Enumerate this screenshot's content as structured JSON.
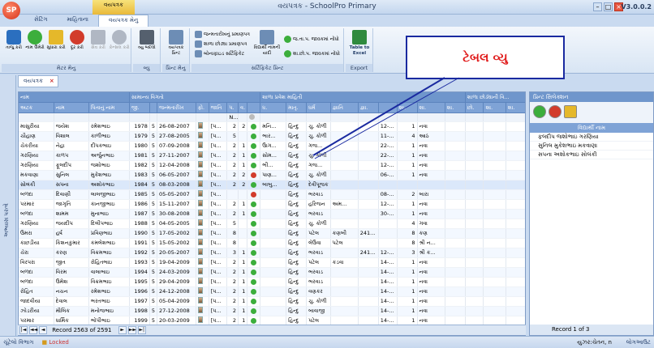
{
  "app": {
    "title": "વયપત્રક - SchoolPro Primary",
    "version": "V3.0.0.2",
    "logo": "SP",
    "context_tab": "વયપત્રક"
  },
  "tabs": [
    "સેટિંગ",
    "માહિતાના",
    "વયપત્રક મેનુ"
  ],
  "ribbon": {
    "groups": [
      "મેટર મેનુ",
      "વ્યુ",
      "પ્રિન્ટ મેનુ",
      "સર્ટિફિકેટ પ્રિન્ટ",
      "Export"
    ],
    "buttons": [
      {
        "label": "તાજું કરો",
        "icon": "refresh-icon",
        "color": "#2b6fbf"
      },
      {
        "label": "નામ ઉમેરો",
        "icon": "add-icon",
        "color": "#3cae3c"
      },
      {
        "label": "સુધારા કરો",
        "icon": "edit-icon",
        "color": "#e5b82a"
      },
      {
        "label": "દૂર કરો",
        "icon": "delete-icon",
        "color": "#d23c2c"
      },
      {
        "label": "સેવ કરો",
        "icon": "save-icon",
        "color": "#b0b7c3"
      },
      {
        "label": "કેન્સલ કરો",
        "icon": "cancel-icon",
        "color": "#b0b7c3"
      }
    ],
    "view_button": "વ્યુ બદલો",
    "print_button": "વયપત્રક પ્રિન્ટ",
    "certs": [
      "જન્મતારીખનું પ્રમાણપત્ર",
      "શાળા છોડ્યા પ્રમાણપત્ર",
      "બોનાફાઇડ સર્ટિફિકેટ"
    ],
    "cert_list_button": "વિદ્યાર્થી નામની યાદી",
    "lists": [
      "જ.તા.પ. જાવકમાં નોંધો",
      "શા.છો.પ. જાવકમાં નોંધો"
    ],
    "export_button": "Table to Excel"
  },
  "callout": "ટેબલ વ્યુ",
  "doc_tab": "વયપત્રક",
  "left_bar": "અભ્યાસ પરત્વે",
  "grid": {
    "bands": [
      "નામ",
      "સામાન્ય વિગતો",
      "શાળા પ્રવેશ માહિતી",
      "શાળા છોડ્યાની વિ..."
    ],
    "columns": [
      "અટક",
      "નામ",
      "પિતાનું નામ",
      "જી.",
      "",
      "જન્મતારીખ",
      "ફો.",
      "જાતિ",
      "પ.",
      "વ.",
      "",
      "ધ.",
      "માતૃ.",
      "ધર્મ",
      "જ્ઞાતિ",
      "જ્ઞા.",
      "",
      "શા.",
      "શા.",
      "શા.",
      "છો.",
      "શા.",
      "શા."
    ],
    "filter_text": "N...",
    "rows": [
      {
        "last": "માસુરીયા",
        "first": "જયેશ",
        "father": "રમેશભાઇ",
        "year": "1978",
        "day": "5",
        "dob": "26-08-2007",
        "p1": "[પ...",
        "n1": "2",
        "n2": "2",
        "status": "green",
        "c1": "મનિ...",
        "c2": "હિન્દુ",
        "c3": "ચુ. કોળી",
        "c4": "",
        "c5": "",
        "c6": "12-...",
        "c7": "1",
        "c8": "નવા"
      },
      {
        "last": "ચૌહાણ",
        "first": "વિશાલ",
        "father": "કાળીભાઇ",
        "year": "1979",
        "day": "5",
        "dob": "27-08-2005",
        "p1": "[પ...",
        "n1": "5",
        "n2": "",
        "status": "green",
        "c1": "ભાર...",
        "c2": "હિન્દુ",
        "c3": "ચુ. કોળી",
        "c4": "",
        "c5": "",
        "c6": "11-...",
        "c7": "4",
        "c8": "આઠ"
      },
      {
        "last": "ચેકરીયા",
        "first": "નેહા",
        "father": "દીપકભાઇ",
        "year": "1980",
        "day": "5",
        "dob": "07-09-2008",
        "p1": "[પ...",
        "n1": "2",
        "n2": "1",
        "status": "green",
        "c1": "ઉાગ...",
        "c2": "હિન્દુ",
        "c3": "ગજ...",
        "c4": "",
        "c5": "",
        "c6": "22-...",
        "c7": "1",
        "c8": "નવા"
      },
      {
        "last": "ગરણિયા",
        "first": "કાળપ",
        "father": "અર્જુનભાઇ",
        "year": "1981",
        "day": "5",
        "dob": "27-11-2007",
        "p1": "[પ...",
        "n1": "2",
        "n2": "1",
        "status": "green",
        "c1": "સોમ...",
        "c2": "હિન્દુ",
        "c3": "ચુ. કોળી",
        "c4": "",
        "c5": "",
        "c6": "22-...",
        "c7": "1",
        "c8": "નવા"
      },
      {
        "last": "ગરણિયા",
        "first": "ફૂલદીપ",
        "father": "જશોભાઇ",
        "year": "1982",
        "day": "5",
        "dob": "12-04-2008",
        "p1": "[પ...",
        "n1": "2",
        "n2": "1",
        "status": "green",
        "c1": "ભી...",
        "c2": "હિન્દુ",
        "c3": "ગજ...",
        "c4": "",
        "c5": "",
        "c6": "12-...",
        "c7": "1",
        "c8": "નવા"
      },
      {
        "last": "મકવાણા",
        "first": "સુનિલ",
        "father": "મુકેશભાઇ",
        "year": "1983",
        "day": "5",
        "dob": "06-05-2007",
        "p1": "[પ...",
        "n1": "2",
        "n2": "2",
        "status": "red",
        "c1": "પાણ...",
        "c2": "હિન્દુ",
        "c3": "ચુ. કોળી",
        "c4": "",
        "c5": "",
        "c6": "06-...",
        "c7": "1",
        "c8": "નવા"
      },
      {
        "last": "સોલંકી",
        "first": "સપના",
        "father": "અશોકભાઇ",
        "year": "1984",
        "day": "5",
        "dob": "08-03-2008",
        "p1": "[પ...",
        "n1": "2",
        "n2": "2",
        "status": "green",
        "c1": "બાબુ...",
        "c2": "હિન્દુ",
        "c3": "દેવીપૂજક",
        "c4": "",
        "c5": "",
        "c6": "",
        "c7": "",
        "c8": ""
      },
      {
        "last": "બળદા",
        "first": "દિવાણી",
        "father": "લાલજીભાઇ",
        "year": "1985",
        "day": "5",
        "dob": "05-05-2007",
        "p1": "[પ...",
        "n1": "",
        "n2": "",
        "status": "red",
        "c1": "",
        "c2": "હિન્દુ",
        "c3": "ભરવાડ",
        "c4": "",
        "c5": "",
        "c6": "08-...",
        "c7": "2",
        "c8": "બારા"
      },
      {
        "last": "પરમાર",
        "first": "જાગૃતિ",
        "father": "કાનજીભાઇ",
        "year": "1986",
        "day": "5",
        "dob": "15-11-2007",
        "p1": "[પ...",
        "n1": "2",
        "n2": "1",
        "status": "green",
        "c1": "",
        "c2": "હિન્દુ",
        "c3": "હરિજન",
        "c4": "અમ...",
        "c5": "",
        "c6": "12-...",
        "c7": "1",
        "c8": "નવા"
      },
      {
        "last": "બળદા",
        "first": "શામમ",
        "father": "મુનાભાઇ",
        "year": "1987",
        "day": "5",
        "dob": "30-08-2008",
        "p1": "[પ...",
        "n1": "2",
        "n2": "1",
        "status": "green",
        "c1": "",
        "c2": "હિન્દુ",
        "c3": "ભરવાડ",
        "c4": "",
        "c5": "",
        "c6": "30-...",
        "c7": "1",
        "c8": "નવા"
      },
      {
        "last": "ગરણિયા",
        "first": "જયદીપ",
        "father": "દિલીપભાઇ",
        "year": "1988",
        "day": "5",
        "dob": "04-05-2005",
        "p1": "[પ...",
        "n1": "5",
        "n2": "",
        "status": "green",
        "c1": "",
        "c2": "હિન્દુ",
        "c3": "ચુ. કોળી",
        "c4": "",
        "c5": "",
        "c6": "",
        "c7": "4",
        "c8": "ગવા"
      },
      {
        "last": "ઉમરા",
        "first": "હર્ષ",
        "father": "પ્રવિણભાઇ",
        "year": "1990",
        "day": "5",
        "dob": "17-05-2002",
        "p1": "[પ...",
        "n1": "8",
        "n2": "",
        "status": "green",
        "c1": "",
        "c2": "હિન્દુ",
        "c3": "પટેલ",
        "c4": "કણબી",
        "c5": "241...",
        "c6": "",
        "c7": "8",
        "c8": "કણ"
      },
      {
        "last": "કાછડીયા",
        "first": "કિશનકુમાર",
        "father": "કમલેશભાઇ",
        "year": "1991",
        "day": "5",
        "dob": "15-05-2002",
        "p1": "[પ...",
        "n1": "8",
        "n2": "",
        "status": "green",
        "c1": "",
        "c2": "હિન્દુ",
        "c3": "લેઉવા",
        "c4": "પટેલ",
        "c5": "",
        "c6": "",
        "c7": "8",
        "c8": "શ્રી ન..."
      },
      {
        "last": "ચેરા",
        "first": "કરણ",
        "father": "વિક્રમભાઇ",
        "year": "1992",
        "day": "5",
        "dob": "20-05-2007",
        "p1": "[પ...",
        "n1": "3",
        "n2": "1",
        "status": "green",
        "c1": "",
        "c2": "હિન્દુ",
        "c3": "ભરવાડ",
        "c4": "",
        "c5": "241...",
        "c6": "12-...",
        "c7": "3",
        "c8": "શ્રી ક..."
      },
      {
        "last": "વિરપરા",
        "first": "જીત",
        "father": "રોહિતભાઇ",
        "year": "1993",
        "day": "5",
        "dob": "19-04-2009",
        "p1": "[પ...",
        "n1": "2",
        "n2": "1",
        "status": "green",
        "c1": "",
        "c2": "હિન્દુ",
        "c3": "પટેલ",
        "c4": "કડવા",
        "c5": "",
        "c6": "14-...",
        "c7": "1",
        "c8": "નવા"
      },
      {
        "last": "બળદા",
        "first": "વિરમ",
        "father": "વાલાભાઇ",
        "year": "1994",
        "day": "5",
        "dob": "24-03-2009",
        "p1": "[પ...",
        "n1": "2",
        "n2": "1",
        "status": "green",
        "c1": "",
        "c2": "હિન્દુ",
        "c3": "ભરવાડ",
        "c4": "",
        "c5": "",
        "c6": "14-...",
        "c7": "1",
        "c8": "નવા"
      },
      {
        "last": "બળદા",
        "first": "ઉમેશ",
        "father": "વિક્રમભાઇ",
        "year": "1995",
        "day": "5",
        "dob": "29-04-2009",
        "p1": "[પ...",
        "n1": "2",
        "n2": "1",
        "status": "green",
        "c1": "",
        "c2": "હિન્દુ",
        "c3": "ભરવાડ",
        "c4": "",
        "c5": "",
        "c6": "14-...",
        "c7": "1",
        "c8": "નવા"
      },
      {
        "last": "રોહિત",
        "first": "નચન",
        "father": "રમેશભાઇ",
        "year": "1996",
        "day": "5",
        "dob": "24-12-2008",
        "p1": "[પ...",
        "n1": "2",
        "n2": "1",
        "status": "green",
        "c1": "",
        "c2": "હિન્દુ",
        "c3": "વણકર",
        "c4": "",
        "c5": "",
        "c6": "14-...",
        "c7": "1",
        "c8": "નવા"
      },
      {
        "last": "જાદવીયા",
        "first": "દેવાલ",
        "father": "ભરતભાઇ",
        "year": "1997",
        "day": "5",
        "dob": "05-04-2009",
        "p1": "[પ...",
        "n1": "2",
        "n2": "1",
        "status": "green",
        "c1": "",
        "c2": "હિન્દુ",
        "c3": "ચુ. કોળી",
        "c4": "",
        "c5": "",
        "c6": "14-...",
        "c7": "1",
        "c8": "નવા"
      },
      {
        "last": "ઝોડરીયા",
        "first": "મૌલિક",
        "father": "મનોજભાઇ",
        "year": "1998",
        "day": "5",
        "dob": "27-12-2008",
        "p1": "[પ...",
        "n1": "2",
        "n2": "1",
        "status": "green",
        "c1": "",
        "c2": "હિન્દુ",
        "c3": "બાવાજી",
        "c4": "",
        "c5": "",
        "c6": "14-...",
        "c7": "1",
        "c8": "નવા"
      },
      {
        "last": "પરમાર",
        "first": "ધાર્મિક",
        "father": "ભોપીભાઇ",
        "year": "1999",
        "day": "5",
        "dob": "20-03-2009",
        "p1": "[પ...",
        "n1": "2",
        "n2": "1",
        "status": "green",
        "c1": "",
        "c2": "હિન્દુ",
        "c3": "પટેલ",
        "c4": "",
        "c5": "",
        "c6": "14-...",
        "c7": "1",
        "c8": "નવા"
      }
    ],
    "selected_index": 6,
    "record_text": "Record 2563 of 2591"
  },
  "panel": {
    "title": "પ્રિન્ટ સિલેક્શન",
    "column": "વિદ્યાર્થી નામ",
    "items": [
      "ફલદીપ જશોભાઇ ગરણિયા",
      "સુનિલ મુકેશભાઇ મકવાણા",
      "સપના અશોકભાઇ સોલંકી"
    ],
    "record_text": "Record 1 of 3"
  },
  "status": {
    "left": "ચૂંટેલો વિભાગ",
    "locked": "Locked",
    "user": "યુઝર:ચેતન, n",
    "right": "લોગઆઉટ"
  },
  "colors": {
    "accent": "#6f96cc",
    "status_green": "#3cae3c",
    "status_red": "#d23c2c",
    "callout_text": "#e01a1a",
    "callout_border": "#1a2aa0"
  }
}
